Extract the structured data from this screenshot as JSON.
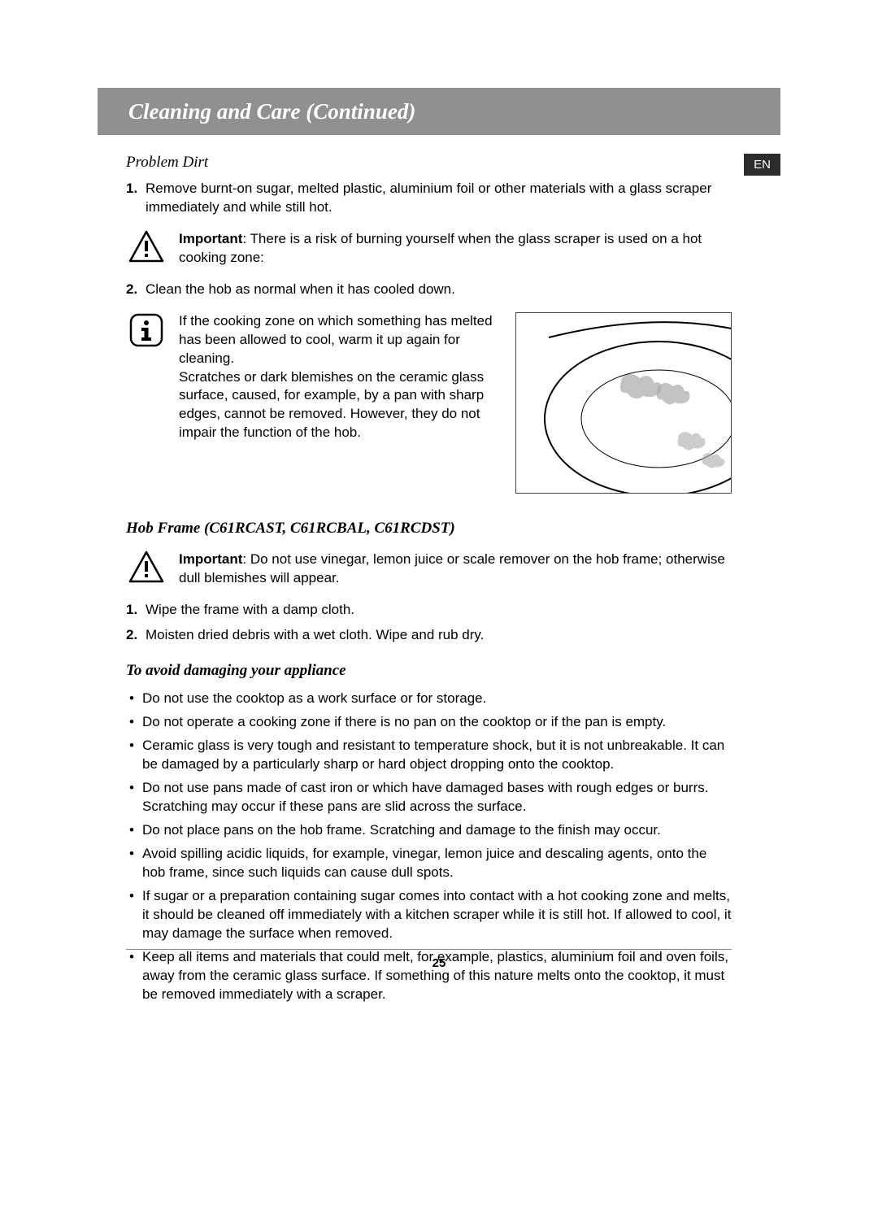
{
  "header": {
    "title": "Cleaning and Care (Continued)",
    "lang": "EN"
  },
  "sec1": {
    "heading": "Problem Dirt",
    "item1_num": "1.",
    "item1": "Remove burnt-on sugar, melted plastic, aluminium foil or other materials with a glass scraper immediately and while still hot.",
    "warn_bold": "Important",
    "warn": ": There is a risk of burning yourself when the glass scraper is used on a hot cooking zone:",
    "item2_num": "2.",
    "item2": "Clean the hob as normal when it has cooled down.",
    "info_p1": "If the cooking zone on which something has melted has been allowed to cool, warm it up again for cleaning.",
    "info_p2": "Scratches or dark blemishes on the ceramic glass surface, caused, for example, by a pan with sharp edges, cannot be removed. However, they do not impair the function of the hob."
  },
  "sec2": {
    "heading": "Hob Frame (C61RCAST, C61RCBAL, C61RCDST)",
    "warn_bold": "Important",
    "warn": ": Do not use vinegar, lemon juice or scale remover on the hob frame; otherwise dull blemishes will appear.",
    "item1_num": "1.",
    "item1": "Wipe the frame with a damp cloth.",
    "item2_num": "2.",
    "item2": "Moisten dried debris with a wet cloth. Wipe and rub dry."
  },
  "sec3": {
    "heading": "To avoid damaging your appliance",
    "bullets": [
      "Do not use the cooktop as a work surface or for storage.",
      "Do not operate a cooking zone if there is no pan on the cooktop or if the pan is empty.",
      "Ceramic glass is very tough and resistant to temperature shock, but it is not unbreakable. It can be damaged by a particularly sharp or hard object dropping onto the cooktop.",
      "Do not use pans made of cast iron or which have damaged bases with rough edges or burrs. Scratching may occur if these pans are slid across the surface.",
      "Do not place pans on the hob frame. Scratching and damage to the finish may occur.",
      "Avoid spilling acidic liquids, for example, vinegar, lemon juice and descaling agents, onto the hob frame, since such liquids can cause dull spots.",
      "If sugar or a preparation containing sugar comes into contact with a hot cooking zone and melts, it should be cleaned off immediately with a kitchen scraper while it is still hot. If allowed to cool, it may damage the surface when removed.",
      "Keep all items and materials that could melt, for example, plastics, aluminium foil and oven foils, away from the ceramic glass surface. If something of this nature melts onto the cooktop, it must be removed immediately with a scraper."
    ]
  },
  "page_number": "25"
}
